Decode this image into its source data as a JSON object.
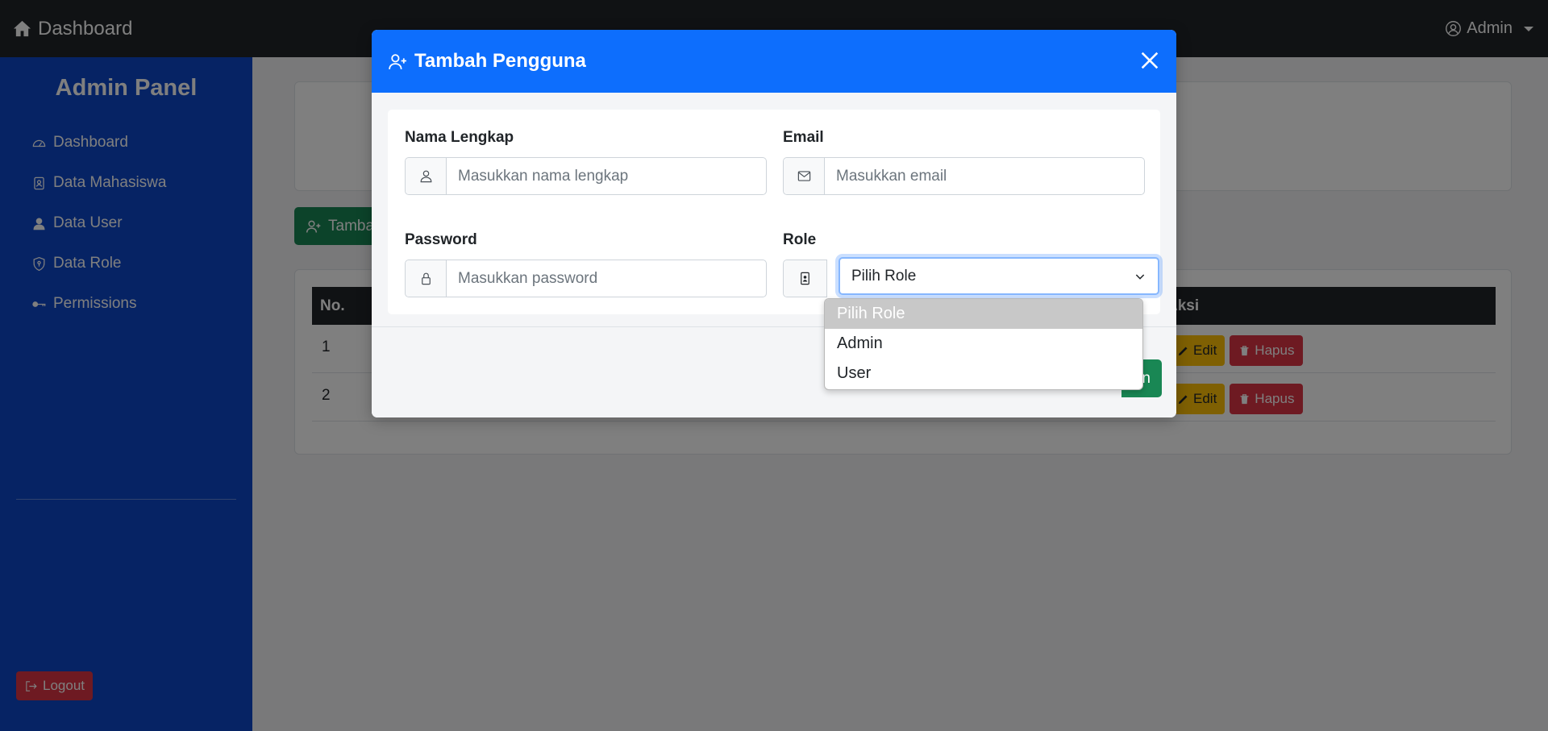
{
  "navbar": {
    "brand": "Dashboard",
    "user": "Admin"
  },
  "sidebar": {
    "title": "Admin Panel",
    "items": [
      {
        "label": "Dashboard",
        "icon": "gauge-icon"
      },
      {
        "label": "Data Mahasiswa",
        "icon": "id-badge-icon"
      },
      {
        "label": "Data User",
        "icon": "person-icon"
      },
      {
        "label": "Data Role",
        "icon": "shield-icon"
      },
      {
        "label": "Permissions",
        "icon": "key-icon"
      }
    ],
    "logout": "Logout"
  },
  "main": {
    "add_button": "Tamba",
    "table": {
      "headers": {
        "no": "No.",
        "aksi": "Aksi"
      },
      "rows": [
        {
          "no": "1",
          "edit": "Edit",
          "delete": "Hapus"
        },
        {
          "no": "2",
          "edit": "Edit",
          "delete": "Hapus"
        }
      ]
    }
  },
  "modal": {
    "title": "Tambah Pengguna",
    "fields": {
      "name": {
        "label": "Nama Lengkap",
        "placeholder": "Masukkan nama lengkap"
      },
      "email": {
        "label": "Email",
        "placeholder": "Masukkan email"
      },
      "password": {
        "label": "Password",
        "placeholder": "Masukkan password"
      },
      "role": {
        "label": "Role",
        "value": "Pilih Role"
      }
    },
    "footer_button": "n",
    "role_options": [
      "Pilih Role",
      "Admin",
      "User"
    ],
    "selected_option": "Pilih Role"
  },
  "colors": {
    "navbar": "#212529",
    "sidebar": "#0d47c8",
    "modal_header": "#0d6efd",
    "success": "#198754",
    "warning": "#ffc107",
    "danger": "#dc3545"
  }
}
